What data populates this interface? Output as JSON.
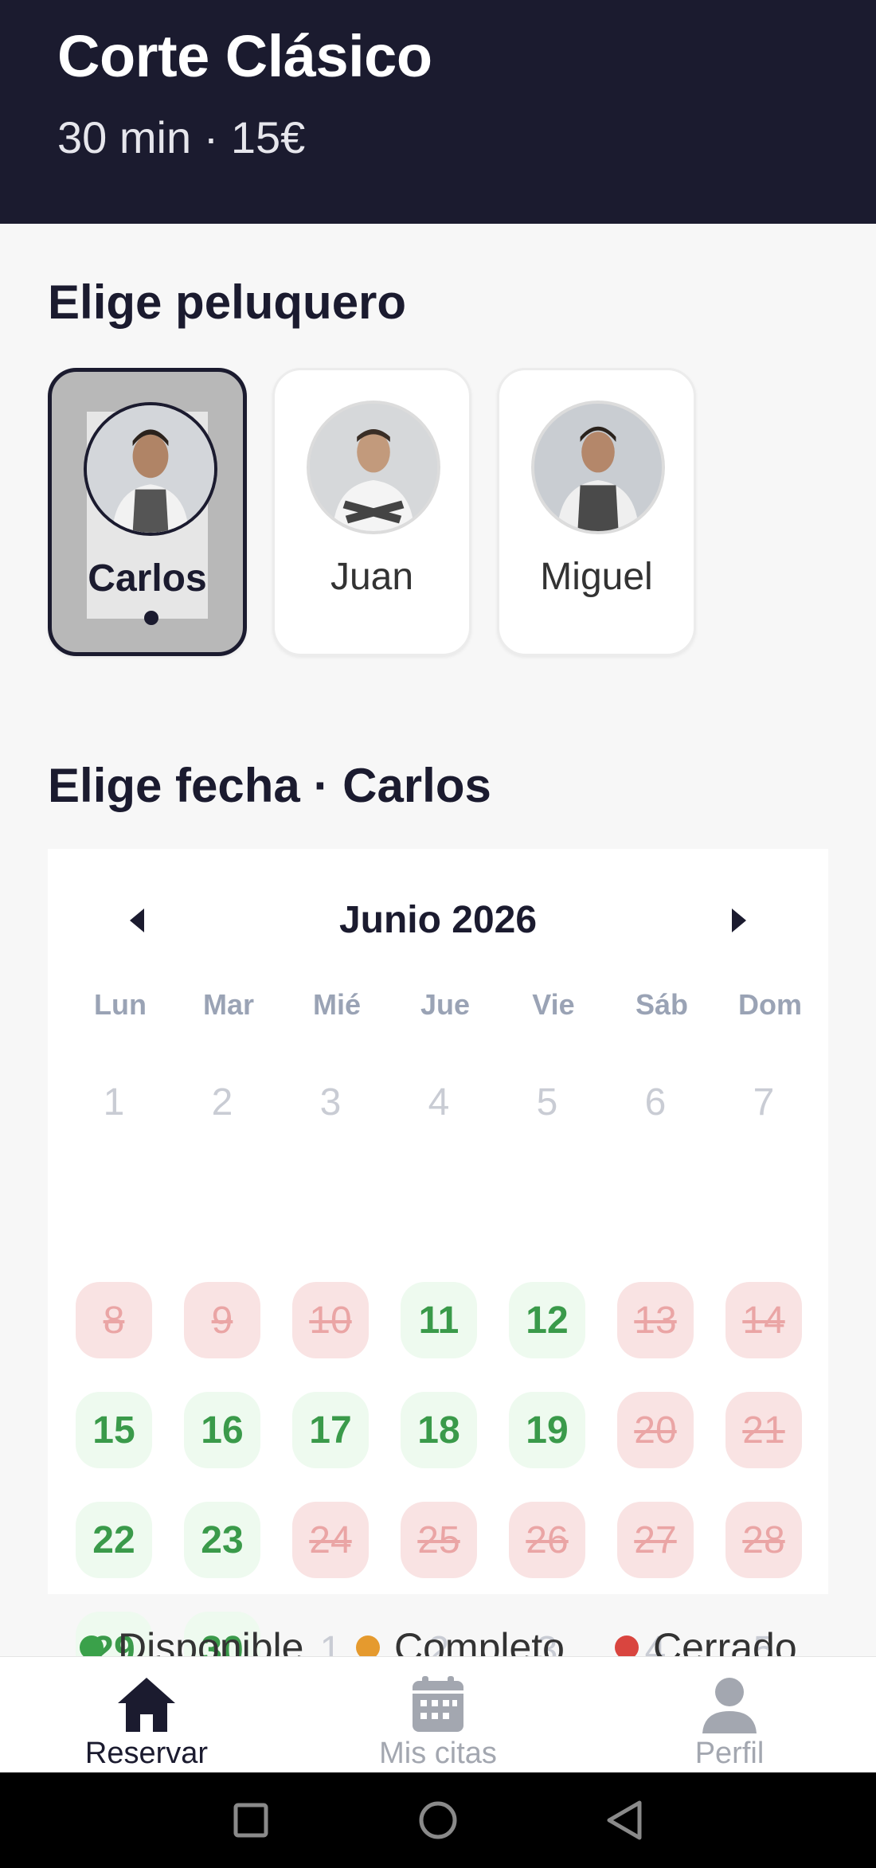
{
  "service": {
    "title": "Corte Clásico",
    "subtitle": "30 min · 15€"
  },
  "barber_section": {
    "title": "Elige peluquero"
  },
  "barbers": [
    {
      "name": "Carlos",
      "selected": true
    },
    {
      "name": "Juan",
      "selected": false
    },
    {
      "name": "Miguel",
      "selected": false
    }
  ],
  "date_section": {
    "title": "Elige fecha · Carlos"
  },
  "calendar": {
    "month": "Junio 2026",
    "weekdays": [
      "Lun",
      "Mar",
      "Mié",
      "Jue",
      "Vie",
      "Sáb",
      "Dom"
    ],
    "weeks": [
      [
        {
          "d": "1",
          "s": "muted"
        },
        {
          "d": "2",
          "s": "muted"
        },
        {
          "d": "3",
          "s": "muted"
        },
        {
          "d": "4",
          "s": "muted"
        },
        {
          "d": "5",
          "s": "muted"
        },
        {
          "d": "6",
          "s": "muted"
        },
        {
          "d": "7",
          "s": "muted"
        }
      ],
      [
        {
          "d": "8",
          "s": "closed"
        },
        {
          "d": "9",
          "s": "closed"
        },
        {
          "d": "10",
          "s": "closed"
        },
        {
          "d": "11",
          "s": "avail"
        },
        {
          "d": "12",
          "s": "avail"
        },
        {
          "d": "13",
          "s": "closed"
        },
        {
          "d": "14",
          "s": "closed"
        }
      ],
      [
        {
          "d": "15",
          "s": "avail"
        },
        {
          "d": "16",
          "s": "avail"
        },
        {
          "d": "17",
          "s": "avail"
        },
        {
          "d": "18",
          "s": "avail"
        },
        {
          "d": "19",
          "s": "avail"
        },
        {
          "d": "20",
          "s": "closed"
        },
        {
          "d": "21",
          "s": "closed"
        }
      ],
      [
        {
          "d": "22",
          "s": "avail"
        },
        {
          "d": "23",
          "s": "avail"
        },
        {
          "d": "24",
          "s": "closed"
        },
        {
          "d": "25",
          "s": "closed"
        },
        {
          "d": "26",
          "s": "closed"
        },
        {
          "d": "27",
          "s": "closed"
        },
        {
          "d": "28",
          "s": "closed"
        }
      ],
      [
        {
          "d": "29",
          "s": "avail"
        },
        {
          "d": "30",
          "s": "avail"
        },
        {
          "d": "1",
          "s": "muted"
        },
        {
          "d": "2",
          "s": "muted"
        },
        {
          "d": "3",
          "s": "muted"
        },
        {
          "d": "4",
          "s": "muted"
        },
        {
          "d": "5",
          "s": "muted"
        }
      ]
    ]
  },
  "legend": [
    {
      "label": "Disponible",
      "color": "#3aa14a"
    },
    {
      "label": "Completo",
      "color": "#e59a2e"
    },
    {
      "label": "Cerrado",
      "color": "#d9453f"
    }
  ],
  "bottom_nav": [
    {
      "label": "Reservar",
      "icon": "home-icon",
      "active": true
    },
    {
      "label": "Mis citas",
      "icon": "calendar-icon",
      "active": false
    },
    {
      "label": "Perfil",
      "icon": "person-icon",
      "active": false
    }
  ],
  "colors": {
    "header_bg": "#1b1b2f",
    "available": "#3a9a4a",
    "closed_bg": "#f9e3e3",
    "closed_text": "#eaa5a5"
  },
  "system_nav": {
    "icons": [
      "recent-apps-icon",
      "home-circle-icon",
      "back-icon"
    ]
  }
}
